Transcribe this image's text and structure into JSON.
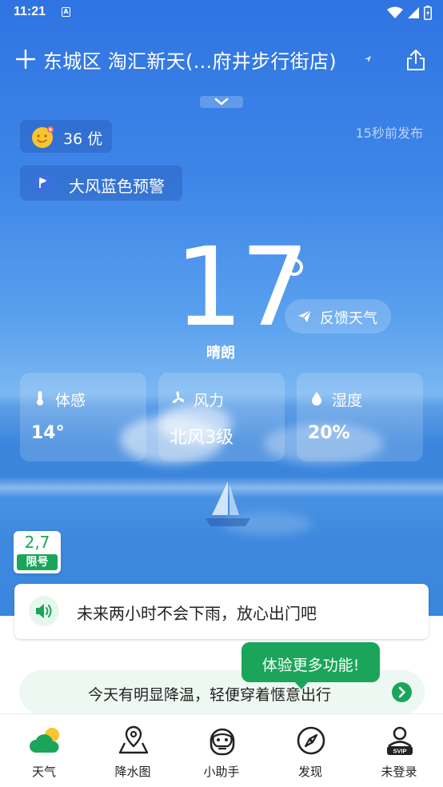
{
  "status_bar": {
    "time": "11:21",
    "notification_icon": "A"
  },
  "header": {
    "location": "东城区 淘汇新天(...府井步行街店)",
    "add_icon": "plus-icon",
    "share_icon": "share-icon"
  },
  "aqi": {
    "value_text": "36 优",
    "face_icon": "smile-face-icon",
    "color": "#f8c531"
  },
  "publish_time": "15秒前发布",
  "warning": {
    "label": "大风蓝色预警",
    "icon": "wind-flag-icon",
    "color": "#3d6fe0"
  },
  "current": {
    "temperature": "17",
    "condition": "晴朗"
  },
  "feedback": {
    "label": "反馈天气",
    "icon": "paper-plane-icon"
  },
  "cards": [
    {
      "label": "体感",
      "value": "14°",
      "icon": "thermometer-icon"
    },
    {
      "label": "风力",
      "value": "北风3级",
      "icon": "fan-icon"
    },
    {
      "label": "湿度",
      "value": "20%",
      "icon": "water-drop-icon"
    }
  ],
  "plate_limit": {
    "numbers": "2,7",
    "label": "限号",
    "color": "#1aa55a"
  },
  "rain_forecast": {
    "text": "未来两小时不会下雨，放心出门吧",
    "icon": "speaker-icon"
  },
  "tip": {
    "text": "体验更多功能!"
  },
  "advice": {
    "text": "今天有明显降温，轻便穿着惬意出行",
    "icon": "chevron-right-icon"
  },
  "tabs": [
    {
      "label": "天气",
      "icon": "weather-cloud-sun-icon",
      "active": true
    },
    {
      "label": "降水图",
      "icon": "map-pin-icon",
      "active": false
    },
    {
      "label": "小助手",
      "icon": "assistant-robot-icon",
      "active": false
    },
    {
      "label": "发现",
      "icon": "compass-icon",
      "active": false
    },
    {
      "label": "未登录",
      "icon": "user-svip-icon",
      "active": false
    }
  ],
  "colors": {
    "sky_top": "#2f74e2",
    "accent_green": "#1aa55a"
  }
}
